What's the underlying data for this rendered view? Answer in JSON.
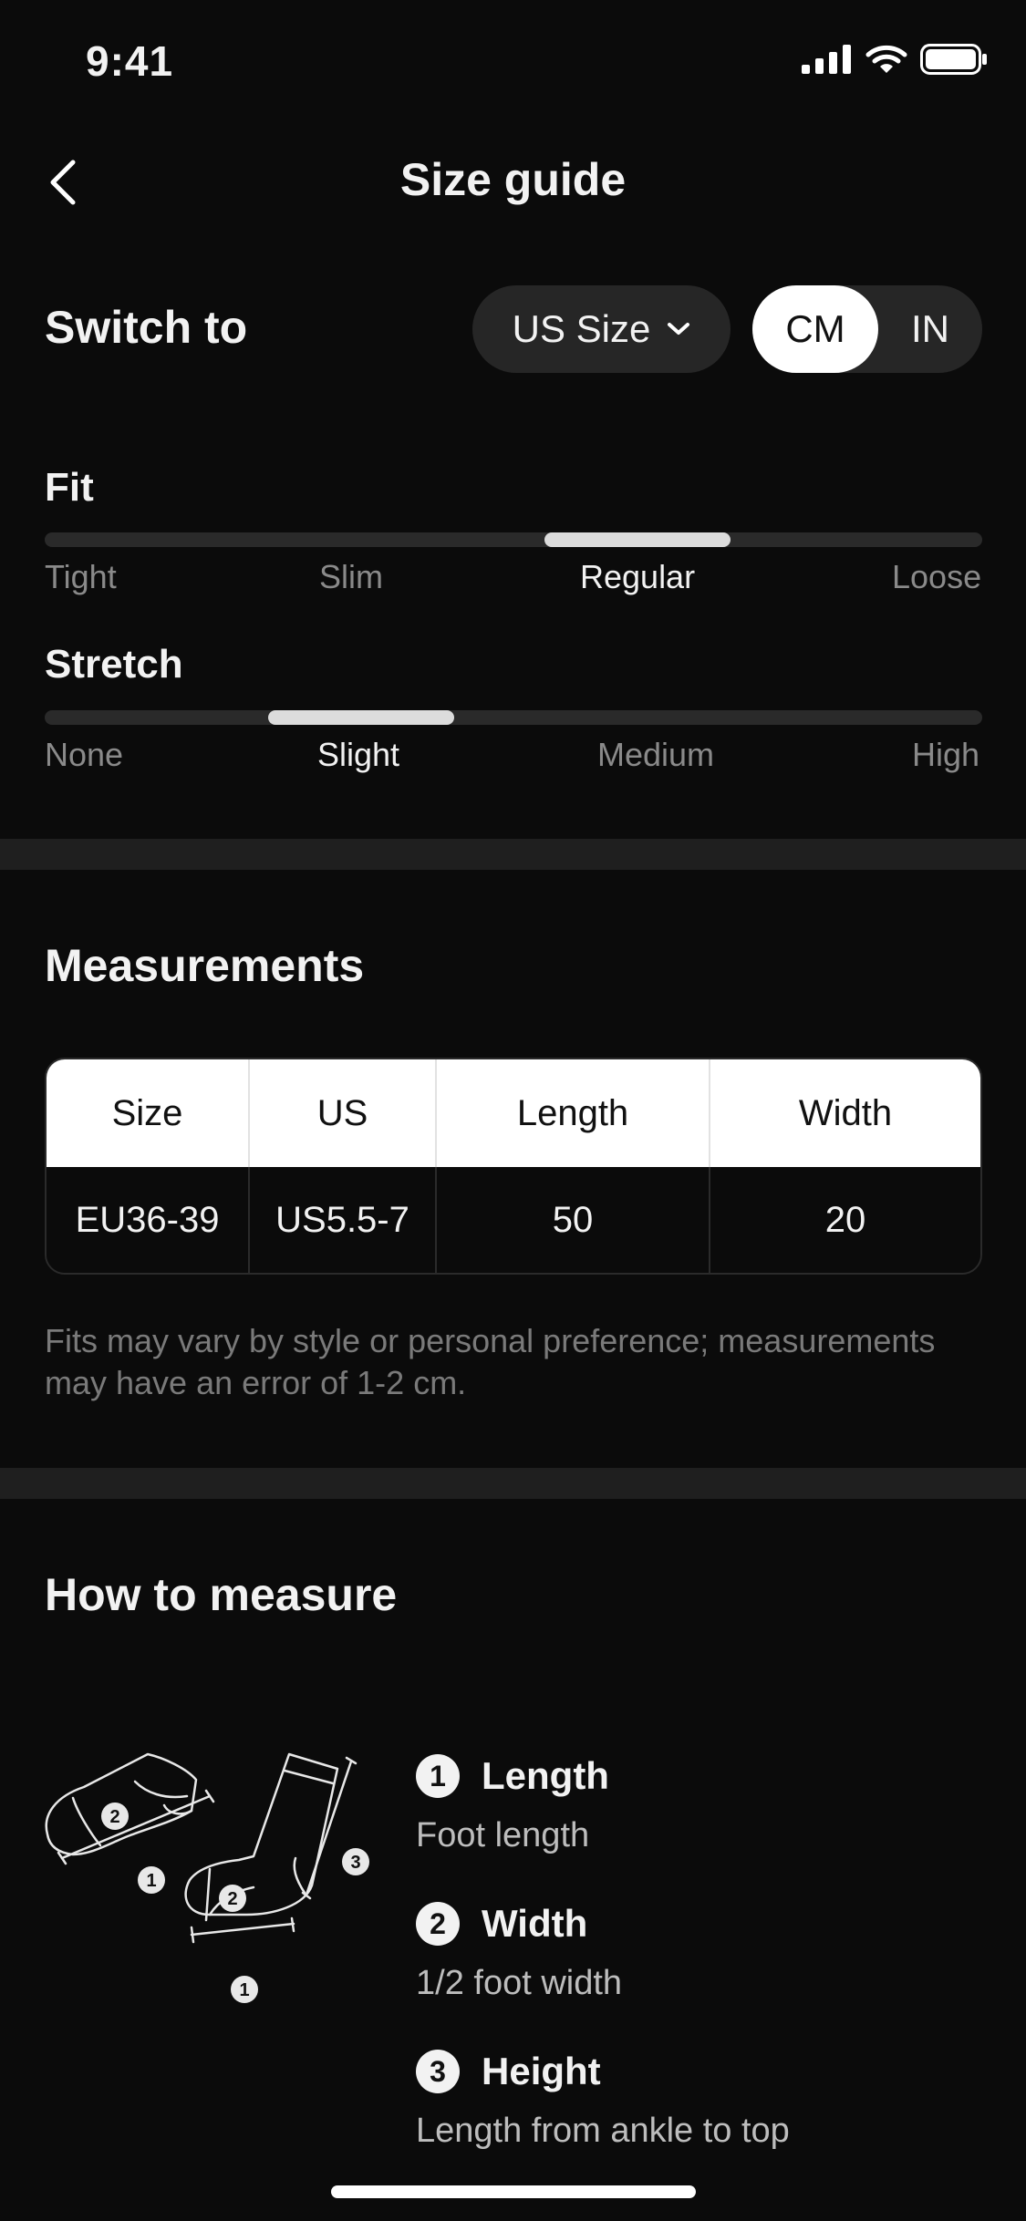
{
  "status_bar": {
    "time": "9:41",
    "icons": [
      "signal-icon",
      "wifi-icon",
      "battery-icon"
    ]
  },
  "nav": {
    "title": "Size guide",
    "back_icon": "chevron-left-icon"
  },
  "switch": {
    "label": "Switch to",
    "size_system": "US Size",
    "units": [
      "CM",
      "IN"
    ],
    "selected_unit": "CM"
  },
  "fit": {
    "title": "Fit",
    "options": [
      "Tight",
      "Slim",
      "Regular",
      "Loose"
    ],
    "selected": "Regular"
  },
  "stretch": {
    "title": "Stretch",
    "options": [
      "None",
      "Slight",
      "Medium",
      "High"
    ],
    "selected": "Slight"
  },
  "measurements": {
    "title": "Measurements",
    "columns": [
      "Size",
      "US",
      "Length",
      "Width"
    ],
    "rows": [
      [
        "EU36-39",
        "US5.5-7",
        "50",
        "20"
      ]
    ],
    "note": "Fits may vary by style or personal preference; measurements may have an error of 1-2 cm."
  },
  "how_to_measure": {
    "title": "How to measure",
    "steps": [
      {
        "num": "1",
        "title": "Length",
        "desc": "Foot length"
      },
      {
        "num": "2",
        "title": "Width",
        "desc": "1/2 foot width"
      },
      {
        "num": "3",
        "title": "Height",
        "desc": "Length from ankle to top"
      }
    ],
    "illustration_labels": [
      "1",
      "2",
      "3"
    ]
  },
  "colors": {
    "background": "#0b0b0b",
    "surface": "#262626",
    "accent": "#ffffff"
  }
}
